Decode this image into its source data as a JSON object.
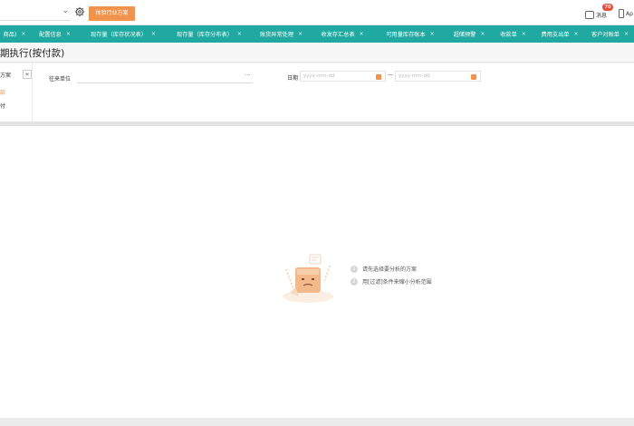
{
  "topbar": {
    "industry_button": "体验行业方案",
    "message_label": "消息",
    "message_count": "70",
    "app_label": "Ap"
  },
  "tabs": [
    {
      "label": "商品)"
    },
    {
      "label": "配置信息"
    },
    {
      "label": "现存量（库存状况表）"
    },
    {
      "label": "现存量（库存分布表）"
    },
    {
      "label": "账货异常处理"
    },
    {
      "label": "收发存汇总表"
    },
    {
      "label": "可用量库存账本"
    },
    {
      "label": "超储预警"
    },
    {
      "label": "收款单"
    },
    {
      "label": "费用支出单"
    },
    {
      "label": "客户对账单"
    }
  ],
  "page": {
    "title": "期执行(按付款)"
  },
  "filter": {
    "side_items": [
      "方案",
      "款",
      "付"
    ],
    "unit_label": "往来单位",
    "unit_dots": "···",
    "date_label": "日期",
    "date_start_placeholder": "yyyy-mm-dd",
    "date_end_placeholder": "yyyy-mm-dd",
    "date_separator": "—",
    "collapse_symbol": "«"
  },
  "empty_state": {
    "hints": [
      {
        "num": "1",
        "text": "请先选择要分析的方案"
      },
      {
        "num": "2",
        "text": "用[过滤]条件来缩小分析范围"
      }
    ]
  },
  "colors": {
    "tab_bar": "#1fa9a0",
    "accent_orange": "#f0934d",
    "badge_red": "#e74c3c"
  }
}
